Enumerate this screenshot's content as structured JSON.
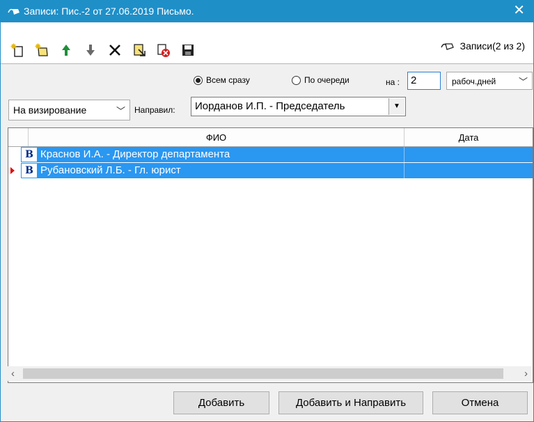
{
  "window": {
    "title": "Записи: Пис.-2 от 27.06.2019 Письмо.",
    "close_glyph": "✕"
  },
  "toolbar": {
    "buttons": [
      "new-record-icon",
      "new-folder-record-icon",
      "move-up-icon",
      "move-down-icon",
      "delete-icon",
      "select-icon",
      "cancel-record-icon",
      "save-icon"
    ],
    "records_label": "Записи(2 из 2)"
  },
  "options": {
    "all_at_once": "Всем сразу",
    "in_turn": "По очереди",
    "selected_mode": "all_at_once",
    "na_label": "на :",
    "days_value": "2",
    "units": "рабоч.дней",
    "route_type": "На визирование",
    "sender_label": "Направил:",
    "sender_value": "Иорданов И.П. - Председатель"
  },
  "table": {
    "columns": [
      "ФИО",
      "Дата"
    ],
    "rows": [
      {
        "status": "В",
        "name": "Краснов И.А. - Директор департамента",
        "date": "",
        "current": false
      },
      {
        "status": "В",
        "name": "Рубановский Л.Б. - Гл. юрист",
        "date": "",
        "current": true
      }
    ]
  },
  "buttons": {
    "add": "Добавить",
    "add_and_send": "Добавить и Направить",
    "cancel": "Отмена"
  },
  "colors": {
    "titlebar": "#1f8fc8",
    "selection": "#2a97f1"
  }
}
